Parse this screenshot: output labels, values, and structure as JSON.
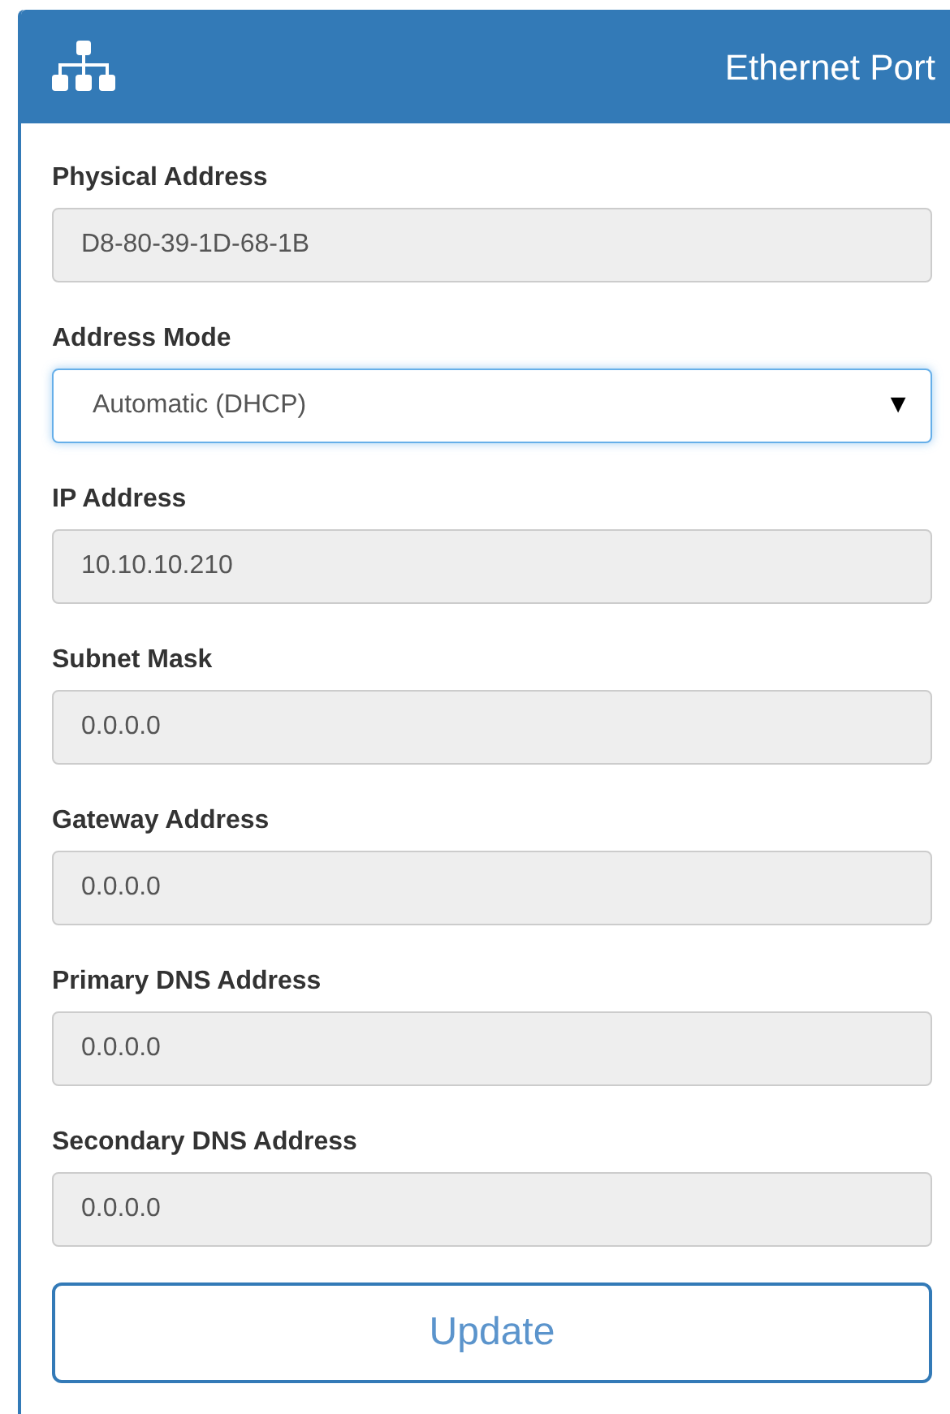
{
  "header": {
    "title": "Ethernet Port"
  },
  "fields": [
    {
      "kind": "readonly",
      "label": "Physical Address",
      "value": "D8-80-39-1D-68-1B"
    },
    {
      "kind": "select",
      "label": "Address Mode",
      "value": "Automatic (DHCP)",
      "arrow": "▼"
    },
    {
      "kind": "readonly",
      "label": "IP Address",
      "value": "10.10.10.210"
    },
    {
      "kind": "readonly",
      "label": "Subnet Mask",
      "value": "0.0.0.0"
    },
    {
      "kind": "readonly",
      "label": "Gateway Address",
      "value": "0.0.0.0"
    },
    {
      "kind": "readonly",
      "label": "Primary DNS Address",
      "value": "0.0.0.0"
    },
    {
      "kind": "readonly",
      "label": "Secondary DNS Address",
      "value": "0.0.0.0"
    }
  ],
  "button": {
    "label": "Update"
  }
}
